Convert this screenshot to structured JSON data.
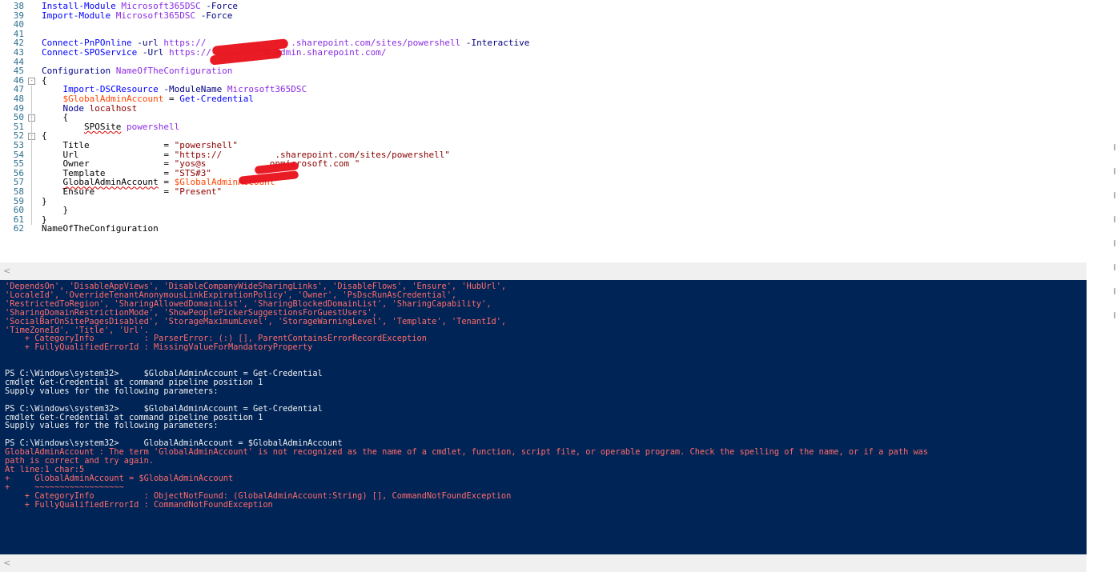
{
  "editor": {
    "lines": [
      {
        "n": "38",
        "t": [
          [
            "cmd",
            "Install-Module "
          ],
          [
            "arg",
            "Microsoft365DSC "
          ],
          [
            "param",
            "-Force"
          ]
        ]
      },
      {
        "n": "39",
        "t": [
          [
            "cmd",
            "Import-Module "
          ],
          [
            "arg",
            "Microsoft365DSC "
          ],
          [
            "param",
            "-Force"
          ]
        ]
      },
      {
        "n": "40",
        "t": []
      },
      {
        "n": "41",
        "t": []
      },
      {
        "n": "42",
        "t": [
          [
            "cmd",
            "Connect-PnPOnline "
          ],
          [
            "param",
            "-url "
          ],
          [
            "arg",
            "https://"
          ],
          [
            "arg",
            "                "
          ],
          [
            "arg",
            ".sharepoint.com/sites/powershell "
          ],
          [
            "param",
            "-Interactive"
          ]
        ]
      },
      {
        "n": "43",
        "t": [
          [
            "cmd",
            "Connect-SPOService "
          ],
          [
            "param",
            "-Url "
          ],
          [
            "arg",
            "https://"
          ],
          [
            "arg",
            "          "
          ],
          [
            "arg",
            "u-admin.sharepoint.com/"
          ]
        ]
      },
      {
        "n": "44",
        "t": []
      },
      {
        "n": "45",
        "t": [
          [
            "kw",
            "Configuration "
          ],
          [
            "arg",
            "NameOfTheConfiguration"
          ]
        ]
      },
      {
        "n": "46",
        "t": [
          [
            "plain",
            "{"
          ]
        ]
      },
      {
        "n": "47",
        "t": [
          [
            "plain",
            "    "
          ],
          [
            "cmd",
            "Import-DSCResource "
          ],
          [
            "param",
            "-ModuleName "
          ],
          [
            "arg",
            "Microsoft365DSC"
          ]
        ]
      },
      {
        "n": "48",
        "t": [
          [
            "plain",
            "    "
          ],
          [
            "var",
            "$GlobalAdminAccount"
          ],
          [
            "plain",
            " = "
          ],
          [
            "cmd",
            "Get-Credential"
          ]
        ]
      },
      {
        "n": "49",
        "t": [
          [
            "plain",
            "    "
          ],
          [
            "kw",
            "Node "
          ],
          [
            "str",
            "localhost"
          ]
        ]
      },
      {
        "n": "50",
        "t": [
          [
            "plain",
            "    {"
          ]
        ]
      },
      {
        "n": "51",
        "t": [
          [
            "plain",
            "        "
          ],
          [
            "sq",
            "SPOSite"
          ],
          [
            "plain",
            " "
          ],
          [
            "arg",
            "powershell"
          ]
        ]
      },
      {
        "n": "52",
        "t": [
          [
            "plain",
            "{"
          ]
        ]
      },
      {
        "n": "53",
        "t": [
          [
            "plain",
            "    Title              = "
          ],
          [
            "str",
            "\"powershell\""
          ]
        ]
      },
      {
        "n": "54",
        "t": [
          [
            "plain",
            "    Url                = "
          ],
          [
            "str",
            "\"https://          .sharepoint.com/sites/powershell\""
          ]
        ]
      },
      {
        "n": "55",
        "t": [
          [
            "plain",
            "    Owner              = "
          ],
          [
            "str",
            "\"yos@s           .onmicrosoft.com \""
          ]
        ]
      },
      {
        "n": "56",
        "t": [
          [
            "plain",
            "    Template           = "
          ],
          [
            "str",
            "\"STS#3\""
          ]
        ]
      },
      {
        "n": "57",
        "t": [
          [
            "plain",
            "    "
          ],
          [
            "sq",
            "GlobalAdminAccount"
          ],
          [
            "plain",
            " = "
          ],
          [
            "var",
            "$GlobalAdminAccount"
          ]
        ]
      },
      {
        "n": "58",
        "t": [
          [
            "plain",
            "    Ensure             = "
          ],
          [
            "str",
            "\"Present\""
          ]
        ]
      },
      {
        "n": "59",
        "t": [
          [
            "plain",
            "}"
          ]
        ]
      },
      {
        "n": "60",
        "t": [
          [
            "plain",
            "    }"
          ]
        ]
      },
      {
        "n": "61",
        "t": [
          [
            "plain",
            "}"
          ]
        ]
      },
      {
        "n": "62",
        "t": [
          [
            "plain",
            "NameOfTheConfiguration"
          ]
        ]
      }
    ]
  },
  "console": {
    "lines": [
      {
        "c": "cerr",
        "t": "'DependsOn', 'DisableAppViews', 'DisableCompanyWideSharingLinks', 'DisableFlows', 'Ensure', 'HubUrl',"
      },
      {
        "c": "cerr",
        "t": "'LocaleId', 'OverrideTenantAnonymousLinkExpirationPolicy', 'Owner', 'PsDscRunAsCredential',"
      },
      {
        "c": "cerr",
        "t": "'RestrictedToRegion', 'SharingAllowedDomainList', 'SharingBlockedDomainList', 'SharingCapability',"
      },
      {
        "c": "cerr",
        "t": "'SharingDomainRestrictionMode', 'ShowPeoplePickerSuggestionsForGuestUsers',"
      },
      {
        "c": "cerr",
        "t": "'SocialBarOnSitePagesDisabled', 'StorageMaximumLevel', 'StorageWarningLevel', 'Template', 'TenantId',"
      },
      {
        "c": "cerr",
        "t": "'TimeZoneId', 'Title', 'Url'."
      },
      {
        "c": "cerr",
        "t": "    + CategoryInfo          : ParserError: (:) [], ParentContainsErrorRecordException"
      },
      {
        "c": "cerr",
        "t": "    + FullyQualifiedErrorId : MissingValueForMandatoryProperty"
      },
      {
        "c": "cout",
        "t": ""
      },
      {
        "c": "cout",
        "t": ""
      },
      {
        "c": "cout",
        "t": "PS C:\\Windows\\system32>     $GlobalAdminAccount = Get-Credential"
      },
      {
        "c": "cout",
        "t": "cmdlet Get-Credential at command pipeline position 1"
      },
      {
        "c": "cout",
        "t": "Supply values for the following parameters:"
      },
      {
        "c": "cout",
        "t": ""
      },
      {
        "c": "cout",
        "t": "PS C:\\Windows\\system32>     $GlobalAdminAccount = Get-Credential"
      },
      {
        "c": "cout",
        "t": "cmdlet Get-Credential at command pipeline position 1"
      },
      {
        "c": "cout",
        "t": "Supply values for the following parameters:"
      },
      {
        "c": "cout",
        "t": ""
      },
      {
        "c": "cout",
        "t": "PS C:\\Windows\\system32>     GlobalAdminAccount = $GlobalAdminAccount"
      },
      {
        "c": "cerr",
        "t": "GlobalAdminAccount : The term 'GlobalAdminAccount' is not recognized as the name of a cmdlet, function, script file, or operable program. Check the spelling of the name, or if a path was"
      },
      {
        "c": "cerr",
        "t": "path is correct and try again."
      },
      {
        "c": "cerr",
        "t": "At line:1 char:5"
      },
      {
        "c": "cerr",
        "t": "+     GlobalAdminAccount = $GlobalAdminAccount"
      },
      {
        "c": "cerr",
        "t": "+     ~~~~~~~~~~~~~~~~~~"
      },
      {
        "c": "cerr",
        "t": "    + CategoryInfo          : ObjectNotFound: (GlobalAdminAccount:String) [], CommandNotFoundException"
      },
      {
        "c": "cerr",
        "t": "    + FullyQualifiedErrorId : CommandNotFoundException"
      }
    ]
  },
  "scrollbar": {
    "left_arrow": "<"
  },
  "colors": {
    "console_bg": "#012456",
    "error_text": "#ff6b6b",
    "redaction": "#e8101a"
  }
}
